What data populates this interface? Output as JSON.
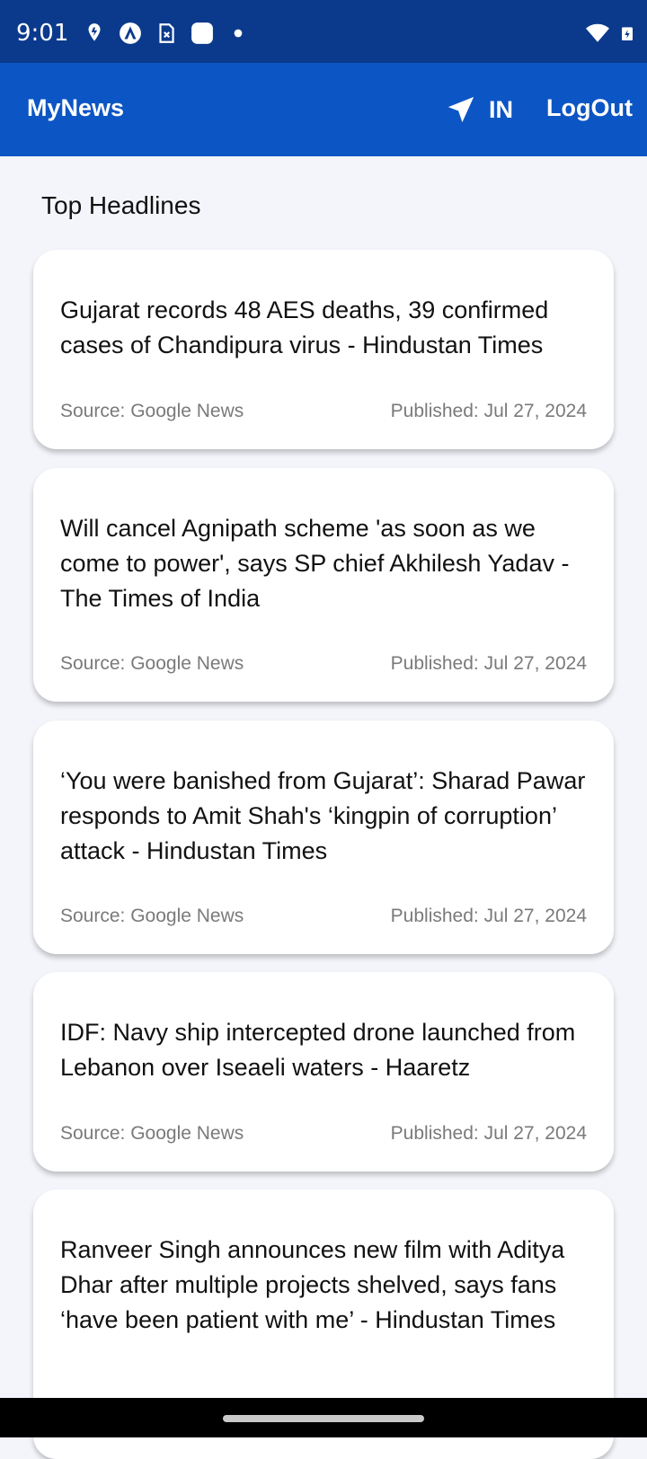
{
  "status_bar": {
    "time": "9:01",
    "icons_left": [
      "location-pin-icon",
      "app-a-icon",
      "sim-card-icon",
      "square-app-icon",
      "dot-icon"
    ],
    "icons_right": [
      "wifi-icon",
      "battery-charging-icon"
    ]
  },
  "app_bar": {
    "title": "MyNews",
    "country_icon": "navigation-arrow-icon",
    "country": "IN",
    "logout": "LogOut",
    "color": "#0c55c4"
  },
  "section_title": "Top Headlines",
  "articles": [
    {
      "title": "Gujarat records 48 AES deaths, 39 confirmed cases of Chandipura virus - Hindustan Times",
      "source": "Source: Google News",
      "published": "Published: Jul 27, 2024"
    },
    {
      "title": "Will cancel Agnipath scheme 'as soon as we come to power', says SP chief Akhilesh Yadav - The Times of India",
      "source": "Source: Google News",
      "published": "Published: Jul 27, 2024"
    },
    {
      "title": "‘You were banished from Gujarat’: Sharad Pawar responds to Amit Shah's ‘kingpin of corruption’ attack - Hindustan Times",
      "source": "Source: Google News",
      "published": "Published: Jul 27, 2024"
    },
    {
      "title": "IDF: Navy ship intercepted drone launched from Lebanon over Iseaeli waters - Haaretz",
      "source": "Source: Google News",
      "published": "Published: Jul 27, 2024"
    },
    {
      "title": "Ranveer Singh announces new film with Aditya Dhar after multiple projects shelved, says fans ‘have been patient with me’ - Hindustan Times",
      "source": "",
      "published": ""
    }
  ]
}
